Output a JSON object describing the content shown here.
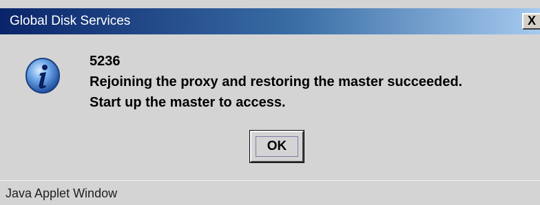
{
  "window": {
    "title": "Global Disk Services",
    "close_label": "X"
  },
  "message": {
    "icon": "info-icon",
    "code": "5236",
    "line1": "Rejoining the proxy and restoring the master succeeded.",
    "line2": "Start up the master to access."
  },
  "buttons": {
    "ok_label": "OK"
  },
  "status": {
    "text": "Java Applet Window"
  },
  "colors": {
    "titlebar_start": "#0a246a",
    "titlebar_end": "#a6caf0",
    "dialog_bg": "#d4d4d4"
  }
}
